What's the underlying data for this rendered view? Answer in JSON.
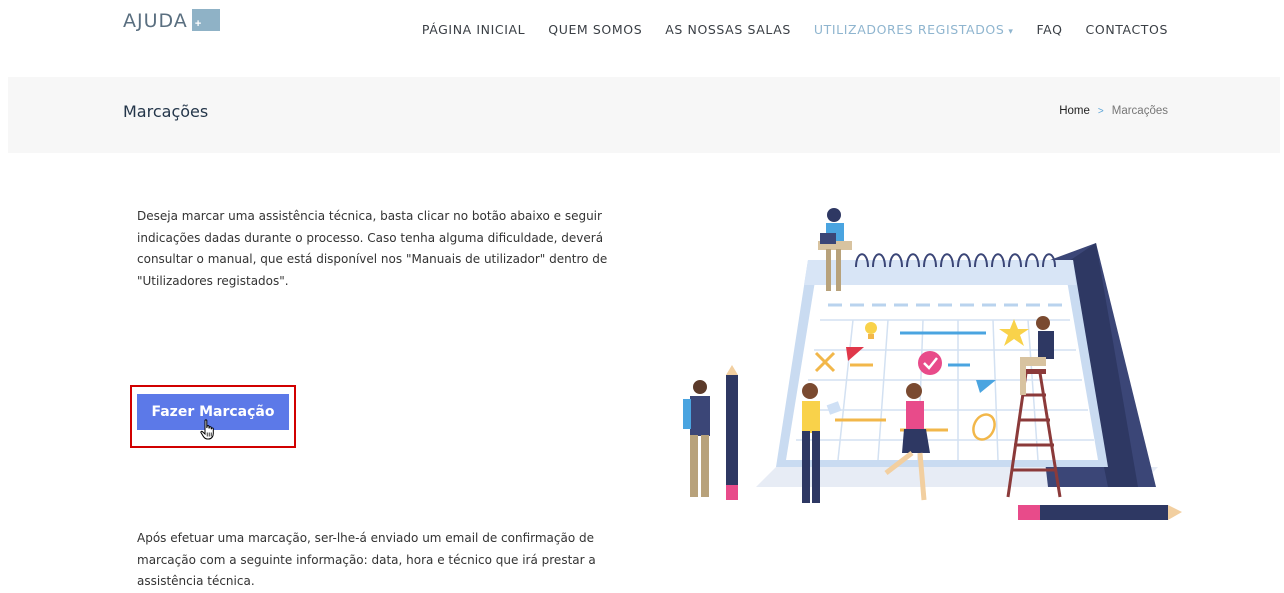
{
  "header": {
    "logo_text": "AJUDA",
    "logo_plus": "+",
    "nav": [
      {
        "label": "PÁGINA INICIAL"
      },
      {
        "label": "QUEM SOMOS"
      },
      {
        "label": "AS NOSSAS SALAS"
      },
      {
        "label": "UTILIZADORES REGISTADOS",
        "active": true,
        "has_dropdown": true
      },
      {
        "label": "FAQ"
      },
      {
        "label": "CONTACTOS"
      }
    ]
  },
  "title_bar": {
    "title": "Marcações",
    "breadcrumb": {
      "home": "Home",
      "separator": ">",
      "current": "Marcações"
    }
  },
  "content": {
    "intro": "Deseja marcar uma assistência técnica, basta clicar no botão abaixo e seguir indicações dadas durante o processo.  Caso tenha alguma dificuldade, deverá consultar o manual, que está disponível nos \"Manuais de utilizador\" dentro de \"Utilizadores registados\".",
    "button_label": "Fazer Marcação",
    "outro": "Após efetuar uma marcação, ser-lhe-á enviado um email de confirmação de marcação com a seguinte informação: data, hora e técnico que irá prestar a assistência técnica."
  },
  "colors": {
    "accent_nav": "#8fb5cf",
    "button": "#5c79e8",
    "highlight_frame": "#d10000",
    "breadcrumb_sep": "#5ba3d6"
  }
}
